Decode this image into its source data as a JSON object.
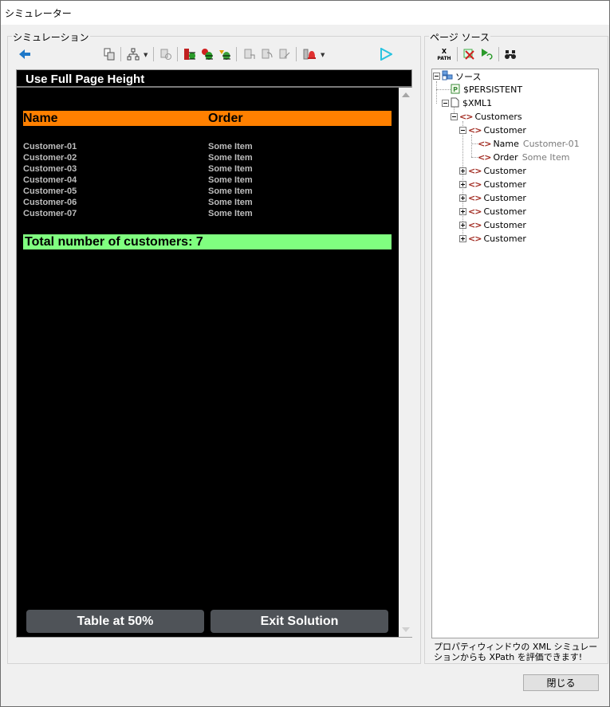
{
  "window": {
    "title": "シミュレーター"
  },
  "simulation": {
    "group_label": "シミュレーション",
    "screen_title": "Use Full Page Height",
    "table": {
      "headers": [
        "Name",
        "Order"
      ],
      "rows": [
        [
          "Customer-01",
          "Some Item"
        ],
        [
          "Customer-02",
          "Some Item"
        ],
        [
          "Customer-03",
          "Some Item"
        ],
        [
          "Customer-04",
          "Some Item"
        ],
        [
          "Customer-05",
          "Some Item"
        ],
        [
          "Customer-06",
          "Some Item"
        ],
        [
          "Customer-07",
          "Some Item"
        ]
      ]
    },
    "total_label": "Total number of customers: 7",
    "buttons": {
      "table50": "Table at 50%",
      "exit": "Exit Solution"
    }
  },
  "page_source": {
    "group_label": "ページ ソース",
    "xpath_icon_text": "X\nPATH",
    "tree": {
      "root": "ソース",
      "persistent": "$PERSISTENT",
      "xml1": "$XML1",
      "customers": "Customers",
      "customer": "Customer",
      "name_label": "Name",
      "name_value": "Customer-01",
      "order_label": "Order",
      "order_value": "Some Item",
      "collapsed_customers": [
        "Customer",
        "Customer",
        "Customer",
        "Customer",
        "Customer",
        "Customer"
      ]
    },
    "hint": "プロパティウィンドウの XML シミュレーションからも XPath を評価できます!"
  },
  "close_button": "閉じる",
  "colors": {
    "header_orange": "#ff8000",
    "total_green": "#80ff80",
    "button_dark": "#4f5358",
    "back_arrow": "#1e78c8",
    "play_arrow": "#29c3e0"
  }
}
